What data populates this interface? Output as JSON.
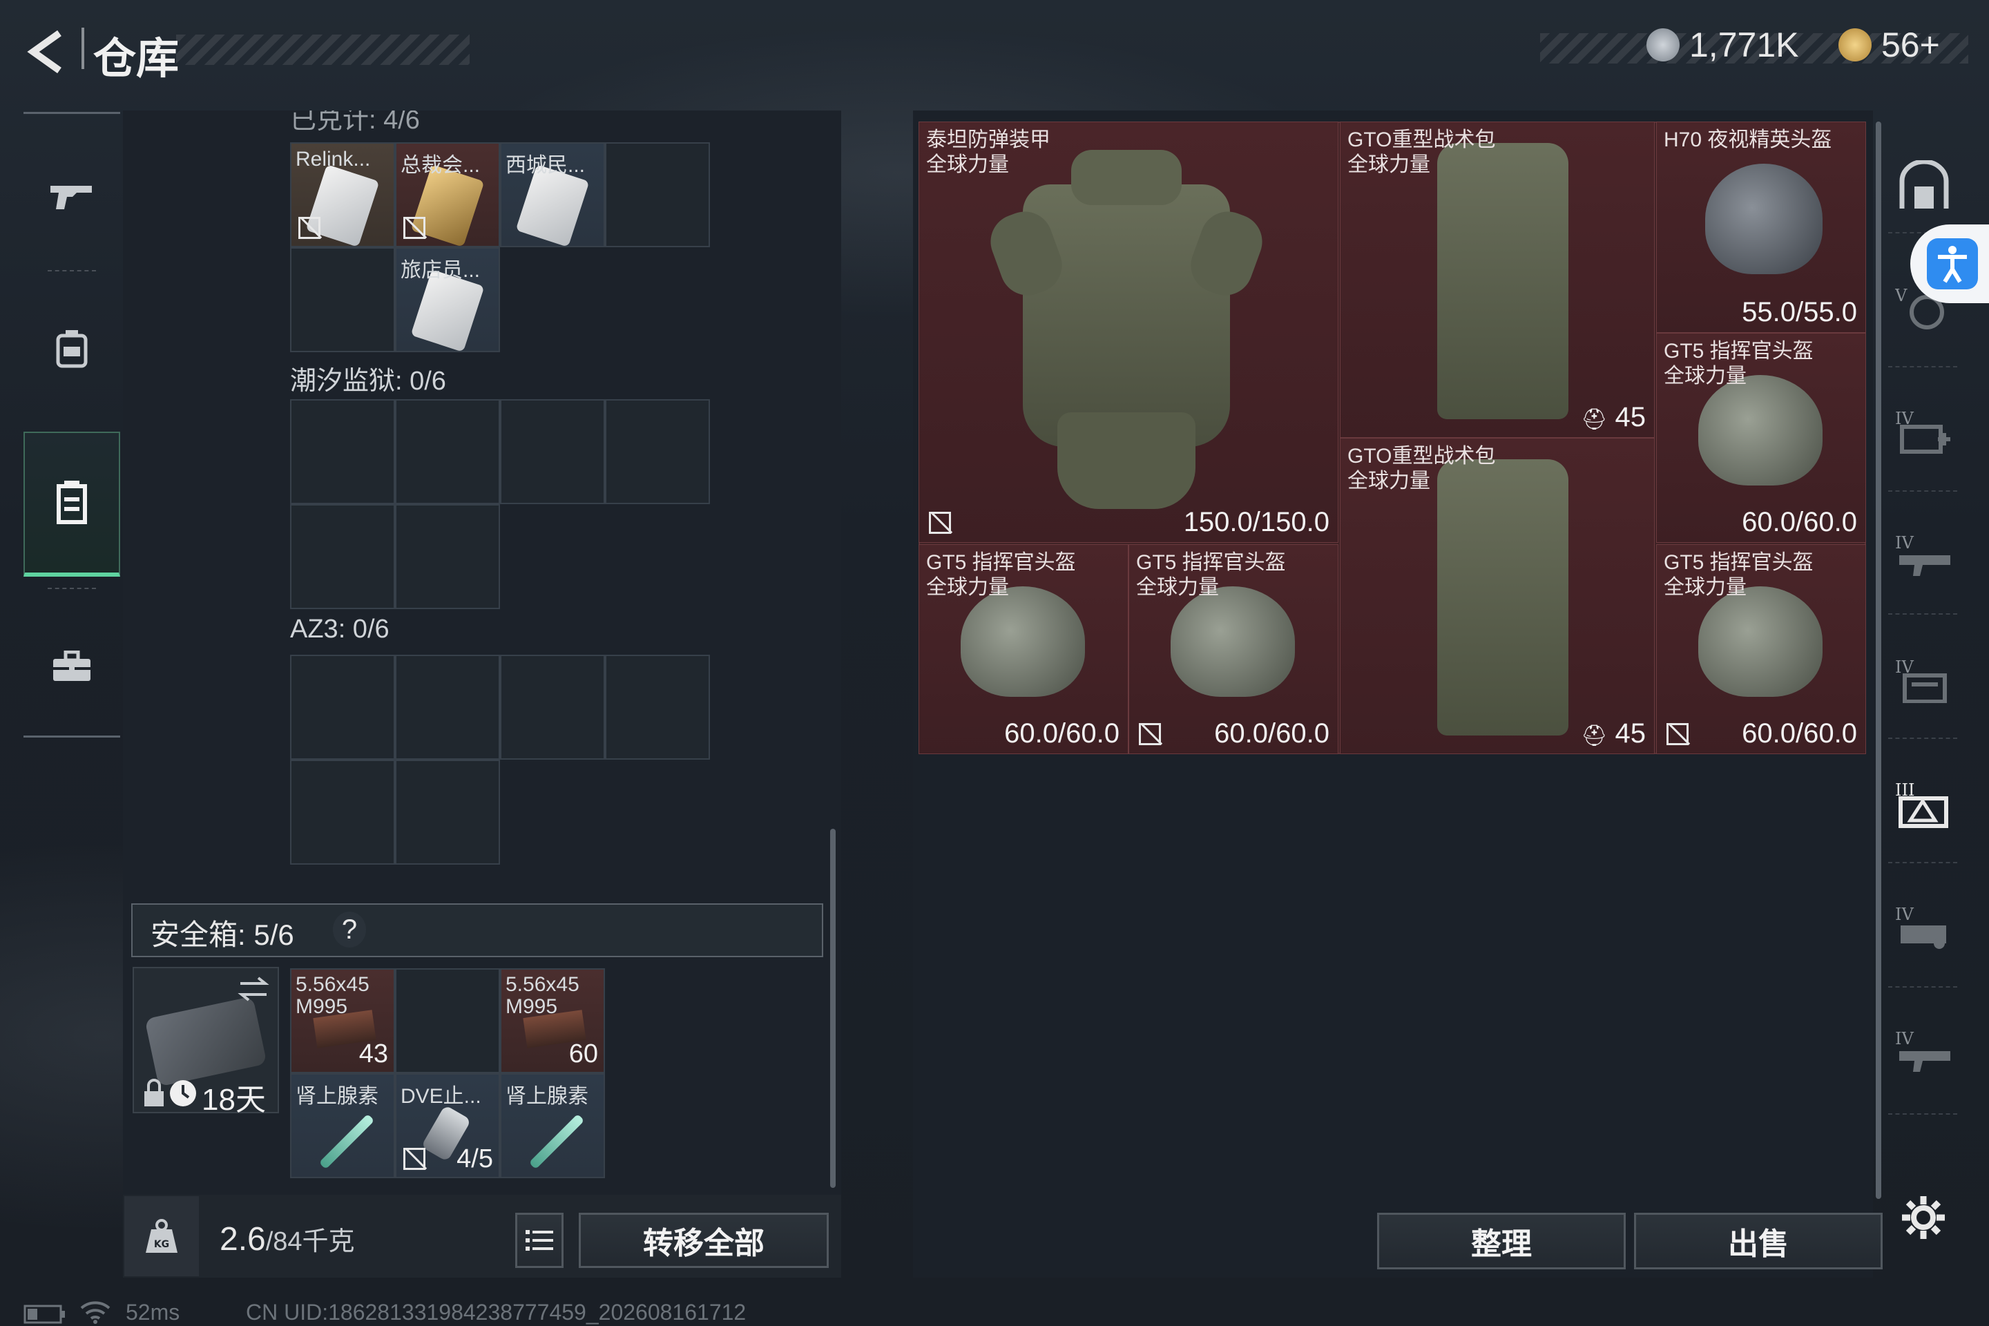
{
  "header": {
    "title": "仓库",
    "currency1": "1,771K",
    "currency2": "56+"
  },
  "left_nav": [
    "weapons-tab",
    "equipment-tab",
    "warehouse-tab",
    "case-tab"
  ],
  "sections": {
    "top_partial": "已兑计: 4/6",
    "s1_items": [
      "Relink...",
      "总裁会...",
      "西城民...",
      "旅店员..."
    ],
    "s2": "潮汐监狱: 0/6",
    "s3": "AZ3: 0/6"
  },
  "safe_box": {
    "label": "安全箱: 5/6",
    "help": "?",
    "days": "18天",
    "items": [
      {
        "name": "5.56x45\nM995",
        "count": "43"
      },
      {
        "name": "5.56x45\nM995",
        "count": "60"
      },
      {
        "name": "肾上腺素",
        "count": ""
      },
      {
        "name": "DVE止...",
        "count": "4/5"
      },
      {
        "name": "肾上腺素",
        "count": ""
      }
    ]
  },
  "bottom": {
    "weight": "2.6",
    "capacity": "/84千克",
    "transfer": "转移全部",
    "sort": "整理",
    "sell": "出售"
  },
  "grid_items": [
    {
      "name": "泰坦防弹装甲\n全球力量",
      "value": "150.0/150.0"
    },
    {
      "name": "GTO重型战术包\n全球力量",
      "value": "45"
    },
    {
      "name": "H70 夜视精英头盔",
      "value": "55.0/55.0"
    },
    {
      "name": "GT5 指挥官头盔\n全球力量",
      "value": "60.0/60.0"
    },
    {
      "name": "GTO重型战术包\n全球力量",
      "value": "45"
    },
    {
      "name": "GT5 指挥官头盔\n全球力量",
      "value": "60.0/60.0"
    },
    {
      "name": "GT5 指挥官头盔\n全球力量",
      "value": "60.0/60.0"
    },
    {
      "name": "GT5 指挥官头盔\n全球力量",
      "value": "60.0/60.0"
    }
  ],
  "footer": {
    "ping": "52ms",
    "uid": "CN UID:186281331984238777459_202608161712"
  },
  "colors": {
    "accent": "#5fd3a0",
    "item_bg": "#4a2529"
  }
}
